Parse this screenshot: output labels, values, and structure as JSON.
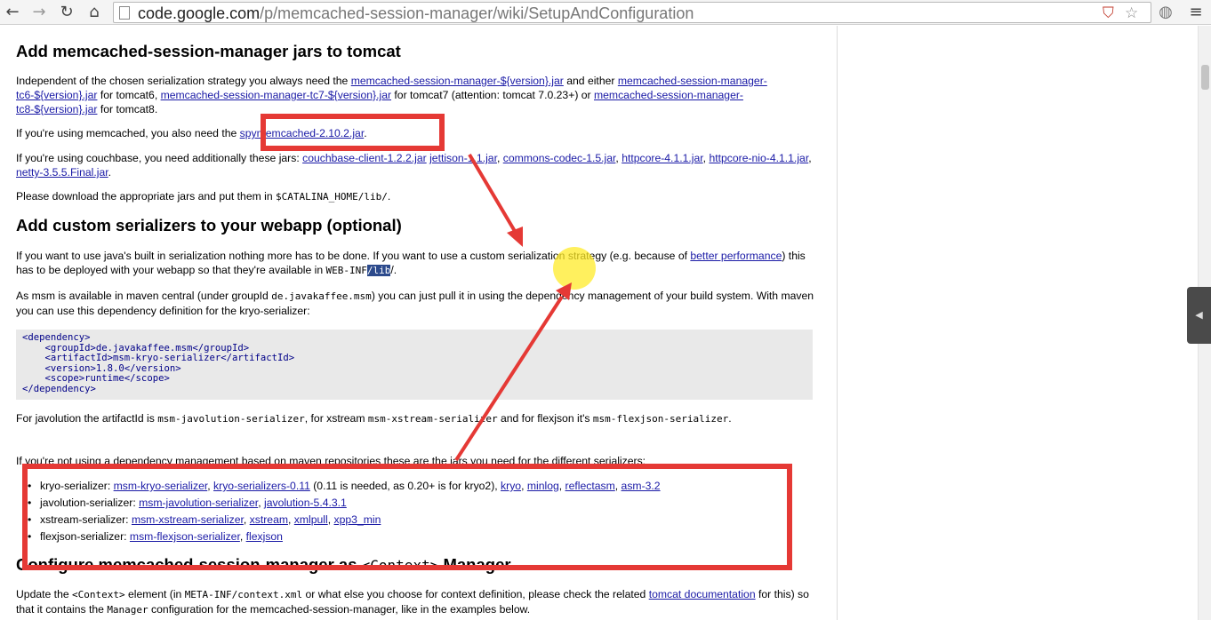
{
  "browser": {
    "url_host": "code.google.com",
    "url_path": "/p/memcached-session-manager/wiki/SetupAndConfiguration",
    "back_icon": "back-arrow-icon",
    "forward_icon": "forward-arrow-icon",
    "reload_icon": "reload-icon",
    "home_icon": "home-icon",
    "star_icon": "bookmark-star-icon",
    "menu_icon": "menu-icon"
  },
  "section1": {
    "heading": "Add memcached-session-manager jars to tomcat",
    "p1": {
      "t1": "Independent of the chosen serialization strategy you always need the ",
      "l1": "memcached-session-manager-${version}.jar",
      "t2": " and either ",
      "l2": "memcached-session-manager-tc6-${version}.jar",
      "t3": " for tomcat6, ",
      "l3": "memcached-session-manager-tc7-${version}.jar",
      "t4": " for tomcat7 (attention: tomcat 7.0.23+) or ",
      "l4": "memcached-session-manager-tc8-${version}.jar",
      "t5": " for tomcat8."
    },
    "p2": {
      "t1": "If you're using memcached, you also need the ",
      "l1": "spymemcached-2.10.2.jar",
      "t2": "."
    },
    "p3": {
      "t1": "If you're using couchbase, you need additionally these jars: ",
      "l1": "couchbase-client-1.2.2.jar",
      "l2": "jettison-1.1.jar",
      "l3": "commons-codec-1.5.jar",
      "l4": "httpcore-4.1.1.jar",
      "l5": "httpcore-nio-4.1.1.jar",
      "l6": "netty-3.5.5.Final.jar",
      "sep": ", ",
      "end": "."
    },
    "p4": {
      "t1": "Please download the appropriate jars and put them in ",
      "c1": "$CATALINA_HOME/lib/",
      "t2": "."
    }
  },
  "section2": {
    "heading": "Add custom serializers to your webapp (optional)",
    "p1": {
      "t1": "If you want to use java's built in serialization nothing more has to be done. If you want to use a custom serialization strategy (e.g. because of ",
      "l1": "better performance",
      "t2": ") this has to be deployed with your webapp so that they're available in ",
      "c1": "WEB-INF",
      "c2": "/lib",
      "t3": "/."
    },
    "p2": {
      "t1": "As msm is available in maven central (under groupId ",
      "c1": "de.javakaffee.msm",
      "t2": ") you can just pull it in using the dependency management of your build system. With maven you can use this dependency definition for the kryo-serializer:"
    },
    "code_lines": [
      "<dependency>",
      "    <groupId>de.javakaffee.msm</groupId>",
      "    <artifactId>msm-kryo-serializer</artifactId>",
      "    <version>1.8.0</version>",
      "    <scope>runtime</scope>",
      "</dependency>"
    ],
    "p3": {
      "t1": "For javolution the artifactId is ",
      "c1": "msm-javolution-serializer",
      "t2": ", for xstream ",
      "c2": "msm-xstream-serializer",
      "t3": " and for flexjson it's ",
      "c3": "msm-flexjson-serializer",
      "t4": "."
    },
    "p4": "If you're not using a dependency management based on maven repositories these are the jars you need for the different serializers:",
    "serializers": [
      {
        "name": "kryo-serializer: ",
        "links": [
          "msm-kryo-serializer",
          "kryo-serializers-0.11"
        ],
        "note": " (0.11 is needed, as 0.20+ is for kryo2), ",
        "links2": [
          "kryo",
          "minlog",
          "reflectasm",
          "asm-3.2"
        ]
      },
      {
        "name": "javolution-serializer: ",
        "links": [
          "msm-javolution-serializer",
          "javolution-5.4.3.1"
        ],
        "note": "",
        "links2": []
      },
      {
        "name": "xstream-serializer: ",
        "links": [
          "msm-xstream-serializer",
          "xstream",
          "xmlpull",
          "xpp3_min"
        ],
        "note": "",
        "links2": []
      },
      {
        "name": "flexjson-serializer: ",
        "links": [
          "msm-flexjson-serializer",
          "flexjson"
        ],
        "note": "",
        "links2": []
      }
    ]
  },
  "section3": {
    "heading_a": "Configure memcached-session-manager as ",
    "heading_code": "<Context>",
    "heading_b": " Manager",
    "p1": {
      "t1": "Update the ",
      "c1": "<Context>",
      "t2": " element (in ",
      "c2": "META-INF/context.xml",
      "t3": " or what else you choose for context definition, please check the related ",
      "l1": "tomcat documentation",
      "t4": " for this) so that it contains the ",
      "c3": "Manager",
      "t5": " configuration for the memcached-session-manager, like in the examples below."
    }
  },
  "colors": {
    "annotation_red": "#e53935",
    "link": "#1a1aa6",
    "highlight": "#2c4a8c",
    "cursor_yellow": "#ffeb28"
  }
}
